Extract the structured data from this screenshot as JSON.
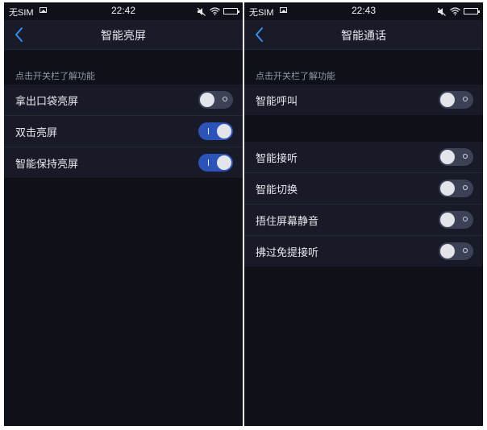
{
  "left": {
    "status": {
      "carrier": "无SIM",
      "time": "22:42"
    },
    "title": "智能亮屏",
    "section_header": "点击开关栏了解功能",
    "items": [
      {
        "label": "拿出口袋亮屏",
        "on": false
      },
      {
        "label": "双击亮屏",
        "on": true
      },
      {
        "label": "智能保持亮屏",
        "on": true
      }
    ]
  },
  "right": {
    "status": {
      "carrier": "无SIM",
      "time": "22:43"
    },
    "title": "智能通话",
    "section_header": "点击开关栏了解功能",
    "group1": [
      {
        "label": "智能呼叫",
        "on": false
      }
    ],
    "group2": [
      {
        "label": "智能接听",
        "on": false
      },
      {
        "label": "智能切换",
        "on": false
      },
      {
        "label": "捂住屏幕静音",
        "on": false
      },
      {
        "label": "拂过免提接听",
        "on": false
      }
    ]
  },
  "colors": {
    "accent": "#2b53b8",
    "background": "#0f1119",
    "row": "#181b27"
  },
  "icons": [
    "back-chevron-icon",
    "photo-icon",
    "mute-icon",
    "wifi-icon",
    "battery-icon"
  ]
}
